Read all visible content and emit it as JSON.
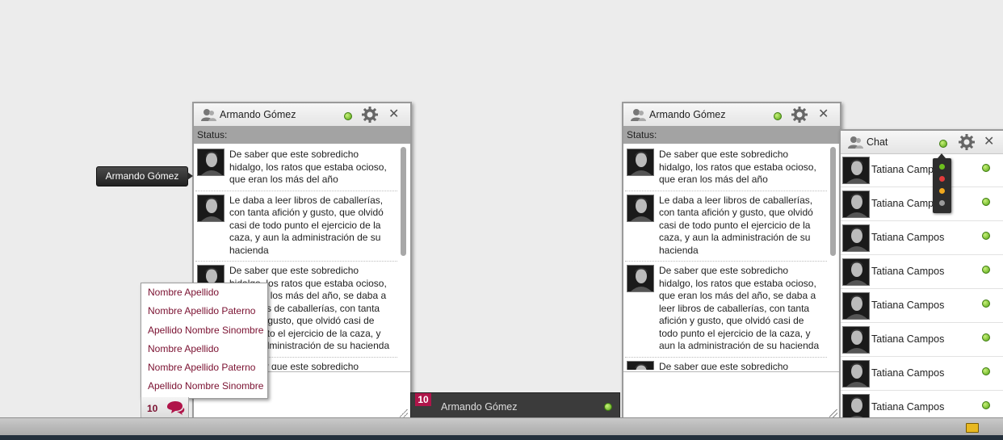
{
  "chat_windows": [
    {
      "title": "Armando Gómez",
      "status_label": "Status:",
      "messages": [
        "De saber que este sobredicho hidalgo, los ratos que estaba ocioso, que eran los más del año",
        "Le daba a leer libros de caballerías, con tanta afición y gusto, que olvidó casi de todo punto el ejercicio de la caza, y aun la administración de su hacienda",
        "De saber que este sobredicho hidalgo, los ratos que estaba ocioso, que eran los más del año, se daba a leer libros de caballerías, con tanta afición y gusto, que olvidó casi de todo punto el ejercicio de la caza, y aun la administración de su hacienda",
        "De saber que este sobredicho"
      ]
    },
    {
      "title": "Armando Gómez",
      "status_label": "Status:",
      "messages": [
        "De saber que este sobredicho hidalgo, los ratos que estaba ocioso, que eran los más del año",
        "Le daba a leer libros de caballerías, con tanta afición y gusto, que olvidó casi de todo punto el ejercicio de la caza, y aun la administración de su hacienda",
        "De saber que este sobredicho hidalgo, los ratos que estaba ocioso, que eran los más del año, se daba a leer libros de caballerías, con tanta afición y gusto, que olvidó casi de todo punto el ejercicio de la caza, y aun la administración de su hacienda",
        "De saber que este sobredicho"
      ]
    }
  ],
  "tooltip": "Armando Gómez",
  "context_menu": [
    "Nombre Apellido",
    "Nombre Apellido Paterno",
    "Apellido Nombre Sinombre",
    "Nombre Apellido",
    "Nombre Apellido Paterno",
    "Apellido Nombre Sinombre"
  ],
  "chat_counter": "10",
  "minimized_chat": {
    "badge": "10",
    "title": "Armando Gómez"
  },
  "contact_panel": {
    "title": "Chat",
    "contacts": [
      "Tatiana Campos",
      "Tatiana Campos",
      "Tatiana Campos",
      "Tatiana Campos",
      "Tatiana Campos",
      "Tatiana Campos",
      "Tatiana Campos",
      "Tatiana Campos"
    ],
    "status_options": [
      "online",
      "busy",
      "away",
      "offline"
    ]
  },
  "colors": {
    "online": "#6cbf1e",
    "busy": "#e23b3b",
    "away": "#f0a81e",
    "offline": "#9a9a9a",
    "accent": "#b0154a",
    "link": "#7a1030"
  }
}
